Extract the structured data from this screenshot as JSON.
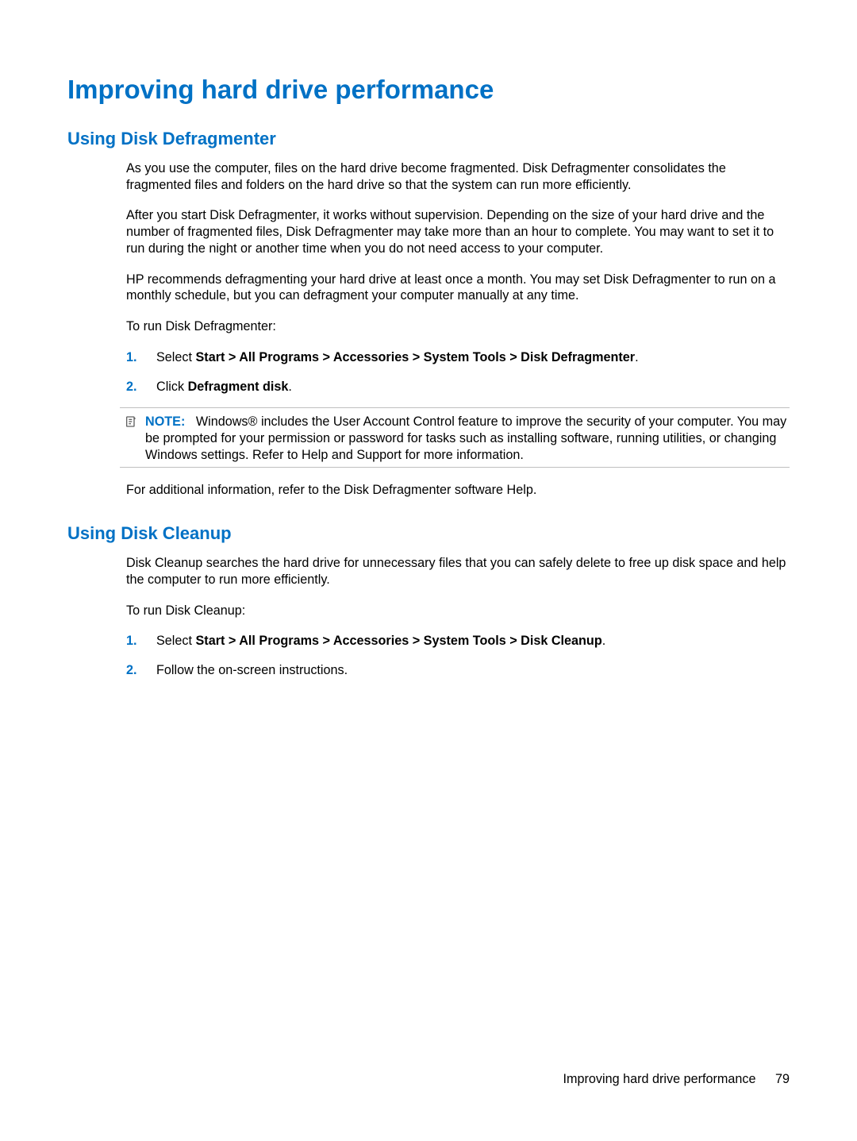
{
  "heading": "Improving hard drive performance",
  "section1": {
    "title": "Using Disk Defragmenter",
    "p1": "As you use the computer, files on the hard drive become fragmented. Disk Defragmenter consolidates the fragmented files and folders on the hard drive so that the system can run more efficiently.",
    "p2": "After you start Disk Defragmenter, it works without supervision. Depending on the size of your hard drive and the number of fragmented files, Disk Defragmenter may take more than an hour to complete. You may want to set it to run during the night or another time when you do not need access to your computer.",
    "p3": "HP recommends defragmenting your hard drive at least once a month. You may set Disk Defragmenter to run on a monthly schedule, but you can defragment your computer manually at any time.",
    "p4": "To run Disk Defragmenter:",
    "list1_marker": "1.",
    "list1_prefix": "Select ",
    "list1_bold": "Start > All Programs > Accessories > System Tools > Disk Defragmenter",
    "list1_suffix": ".",
    "list2_marker": "2.",
    "list2_prefix": "Click ",
    "list2_bold": "Defragment disk",
    "list2_suffix": ".",
    "note_label": "NOTE:",
    "note_text": "Windows® includes the User Account Control feature to improve the security of your computer. You may be prompted for your permission or password for tasks such as installing software, running utilities, or changing Windows settings. Refer to Help and Support for more information.",
    "p5": "For additional information, refer to the Disk Defragmenter software Help."
  },
  "section2": {
    "title": "Using Disk Cleanup",
    "p1": "Disk Cleanup searches the hard drive for unnecessary files that you can safely delete to free up disk space and help the computer to run more efficiently.",
    "p2": "To run Disk Cleanup:",
    "list1_marker": "1.",
    "list1_prefix": "Select ",
    "list1_bold": "Start > All Programs > Accessories > System Tools > Disk Cleanup",
    "list1_suffix": ".",
    "list2_marker": "2.",
    "list2_text": "Follow the on-screen instructions."
  },
  "footer": {
    "title": "Improving hard drive performance",
    "page": "79"
  }
}
